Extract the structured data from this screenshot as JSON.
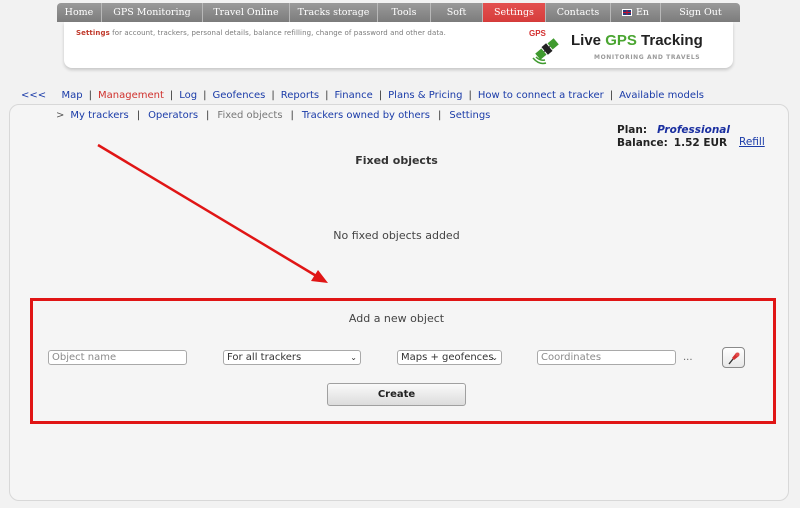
{
  "topnav": {
    "tabs": [
      {
        "label": "Home"
      },
      {
        "label": "GPS Monitoring"
      },
      {
        "label": "Travel Online"
      },
      {
        "label": "Tracks storage"
      },
      {
        "label": "Tools"
      },
      {
        "label": "Soft"
      },
      {
        "label": "Settings"
      },
      {
        "label": "Contacts"
      },
      {
        "label": "En"
      },
      {
        "label": "Sign Out"
      }
    ],
    "active_color": "#d63c3b"
  },
  "header": {
    "desc_bold": "Settings",
    "desc_text": " for account, trackers, personal details, balance refilling, change of password and other data.",
    "logo": {
      "badge": "GPS",
      "brand_pre": "Live ",
      "brand_gps": "GPS",
      "brand_post": " Tracking",
      "tagline": "MONITORING AND TRAVELS"
    }
  },
  "menu": {
    "items": [
      {
        "label": "<<<"
      },
      {
        "label": "Map"
      },
      {
        "label": "Management"
      },
      {
        "label": "Log"
      },
      {
        "label": "Geofences"
      },
      {
        "label": "Reports"
      },
      {
        "label": "Finance"
      },
      {
        "label": "Plans & Pricing"
      },
      {
        "label": "How to connect a tracker"
      },
      {
        "label": "Available models"
      }
    ],
    "separator": "|"
  },
  "submenu": {
    "prefix": ">",
    "items": [
      {
        "label": "My trackers"
      },
      {
        "label": "Operators"
      },
      {
        "label": "Fixed objects"
      },
      {
        "label": "Trackers owned by others"
      },
      {
        "label": "Settings"
      }
    ]
  },
  "account": {
    "plan_label": "Plan:",
    "plan_name": "Professional",
    "balance_label": "Balance:",
    "balance_value": "1.52 EUR",
    "refill": "Refill"
  },
  "main": {
    "title": "Fixed objects",
    "empty_message": "No fixed objects added"
  },
  "add_form": {
    "title": "Add a new object",
    "name_placeholder": "Object name",
    "trackers_select": "For all trackers",
    "display_select": "Maps + geofences",
    "coords_placeholder": "Coordinates",
    "ellipsis": "...",
    "create_button": "Create",
    "highlight_color": "#e01515"
  }
}
